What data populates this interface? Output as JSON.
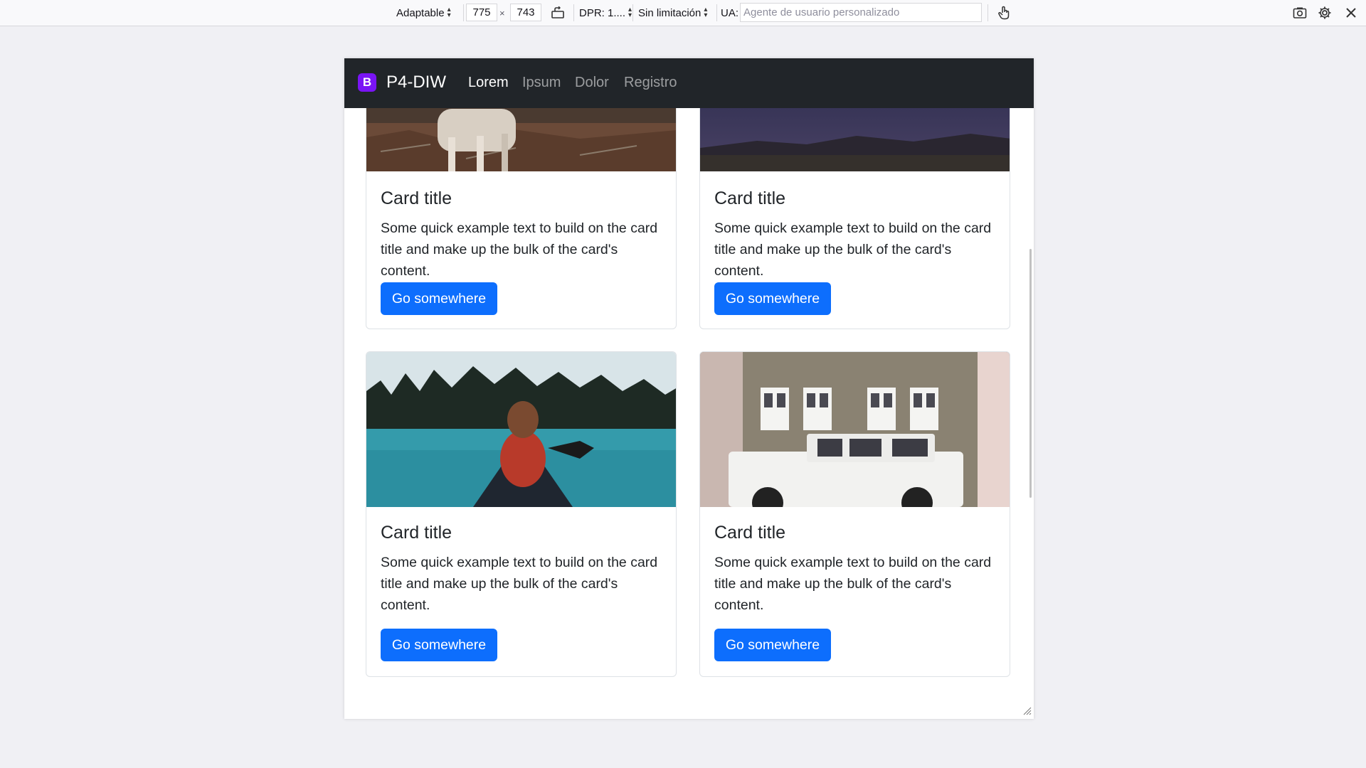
{
  "toolbar": {
    "device_label": "Adaptable",
    "width_value": "775",
    "times_sign": "×",
    "height_value": "743",
    "dpr_label": "DPR: 1....",
    "throttle_label": "Sin limitación",
    "ua_label": "UA:",
    "ua_placeholder": "Agente de usuario personalizado",
    "icons": [
      "rotate-icon",
      "touch-icon",
      "screenshot-icon",
      "settings-icon",
      "close-icon"
    ]
  },
  "navbar": {
    "brand_logo": "B",
    "brand": "P4-DIW",
    "links": [
      "Lorem",
      "Ipsum",
      "Dolor",
      "Registro"
    ],
    "active_index": 0,
    "bg_color": "#212529"
  },
  "cards": [
    {
      "title": "Card title",
      "text": "Some quick example text to build on the card title and make up the bulk of the card's content.",
      "button": "Go somewhere"
    },
    {
      "title": "Card title",
      "text": "Some quick example text to build on the card title and make up the bulk of the card's content.",
      "button": "Go somewhere"
    },
    {
      "title": "Card title",
      "text": "Some quick example text to build on the card title and make up the bulk of the card's content.",
      "button": "Go somewhere"
    },
    {
      "title": "Card title",
      "text": "Some quick example text to build on the card title and make up the bulk of the card's content.",
      "button": "Go somewhere"
    }
  ],
  "colors": {
    "primary": "#0d6efd",
    "brand_purple": "#7a14f5"
  }
}
